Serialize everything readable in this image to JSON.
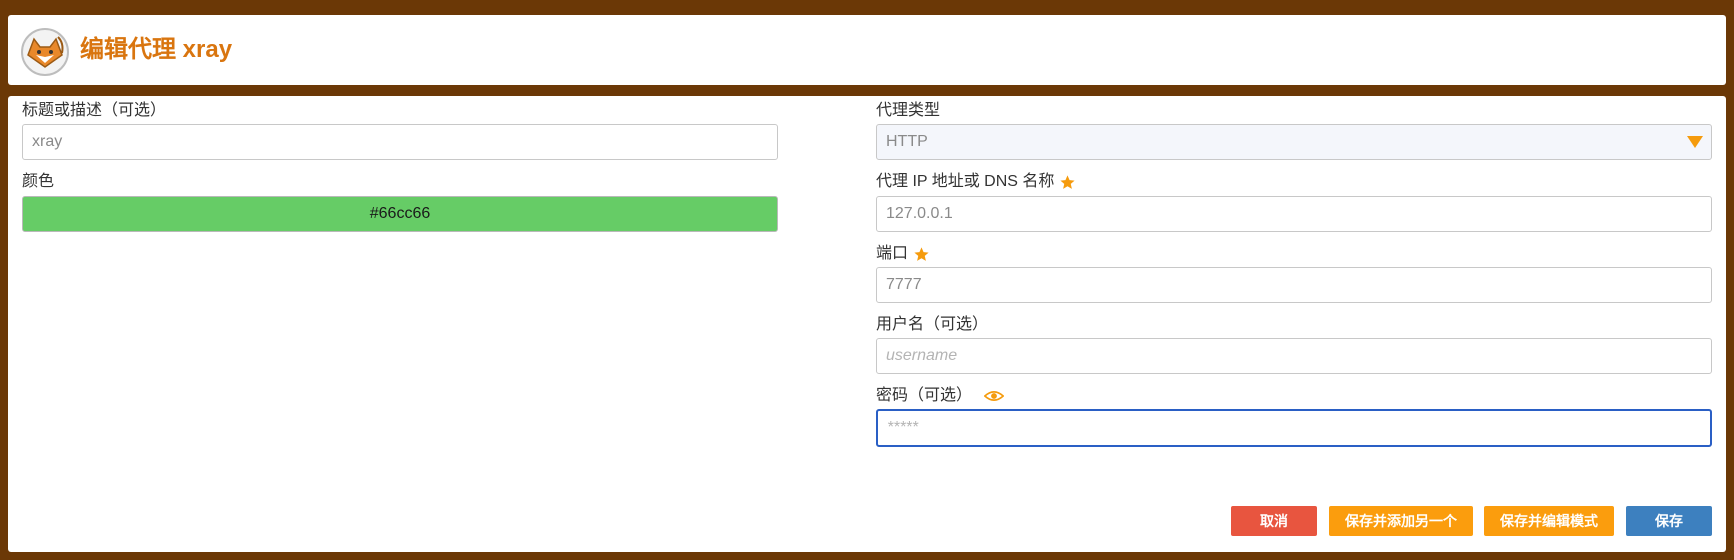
{
  "header": {
    "title": "编辑代理 xray",
    "logo_icon": "fox-logo-icon"
  },
  "form": {
    "title": {
      "label": "标题或描述（可选）",
      "placeholder": "xray"
    },
    "color": {
      "label": "颜色",
      "value": "#66cc66"
    },
    "proxy_type": {
      "label": "代理类型",
      "value": "HTTP",
      "icon": "triangle-down-icon"
    },
    "host": {
      "label": "代理 IP 地址或 DNS 名称",
      "placeholder": "127.0.0.1",
      "required_icon": "star-icon"
    },
    "port": {
      "label": "端口",
      "placeholder": "7777",
      "required_icon": "star-icon"
    },
    "username": {
      "label": "用户名（可选）",
      "placeholder": "username"
    },
    "password": {
      "label": "密码（可选）",
      "placeholder": "*****",
      "reveal_icon": "eye-icon"
    }
  },
  "buttons": {
    "cancel": "取消",
    "save_add": "保存并添加另一个",
    "save_edit": "保存并编辑模式",
    "save": "保存"
  },
  "colors": {
    "background": "#6b3806",
    "accent_orange": "#fb9d0d",
    "title_orange": "#d9750f",
    "cancel_red": "#e8553f",
    "save_blue": "#3d80bf",
    "swatch": "#66cc66"
  }
}
